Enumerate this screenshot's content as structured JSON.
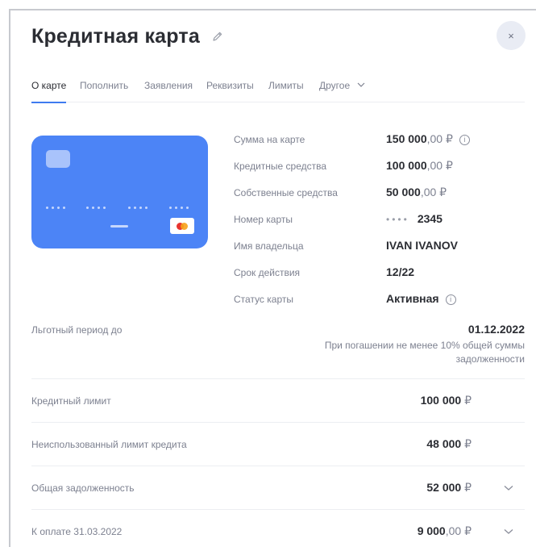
{
  "header": {
    "title": "Кредитная карта",
    "close_label": "×"
  },
  "tabs": [
    {
      "label": "О карте",
      "active": true
    },
    {
      "label": "Пополнить"
    },
    {
      "label": "Заявления"
    },
    {
      "label": "Реквизиты"
    },
    {
      "label": "Лимиты"
    },
    {
      "label": "Другое"
    }
  ],
  "card_info": {
    "balance": {
      "label": "Сумма на карте",
      "int": "150 000",
      "frac": ",00 ₽"
    },
    "credit_funds": {
      "label": "Кредитные средства",
      "int": "100 000",
      "frac": ",00 ₽"
    },
    "own_funds": {
      "label": "Собственные средства",
      "int": "50 000",
      "frac": ",00 ₽"
    },
    "card_number": {
      "label": "Номер карты",
      "mask": "••••",
      "last4": "2345"
    },
    "holder": {
      "label": "Имя владельца",
      "value": "IVAN IVANOV"
    },
    "expiry": {
      "label": "Срок действия",
      "value": "12/22"
    },
    "status": {
      "label": "Статус карты",
      "value": "Активная"
    }
  },
  "grace": {
    "label": "Льготный период до",
    "date": "01.12.2022",
    "note": "При погашении не менее 10% общей суммы задолженности"
  },
  "rows": [
    {
      "label": "Кредитный лимит",
      "int": "100 000",
      "frac": "",
      "cur": " ₽",
      "expandable": false
    },
    {
      "label": "Неиспользованный лимит кредита",
      "int": "48 000",
      "frac": "",
      "cur": " ₽",
      "expandable": false
    },
    {
      "label": "Общая задолженность",
      "int": "52 000",
      "frac": "",
      "cur": " ₽",
      "expandable": true
    },
    {
      "label": "К оплате 31.03.2022",
      "int": "9 000",
      "frac": ",00 ₽",
      "cur": "",
      "expandable": true
    }
  ],
  "colors": {
    "accent": "#3f7bf0",
    "card": "#4c84f6"
  }
}
